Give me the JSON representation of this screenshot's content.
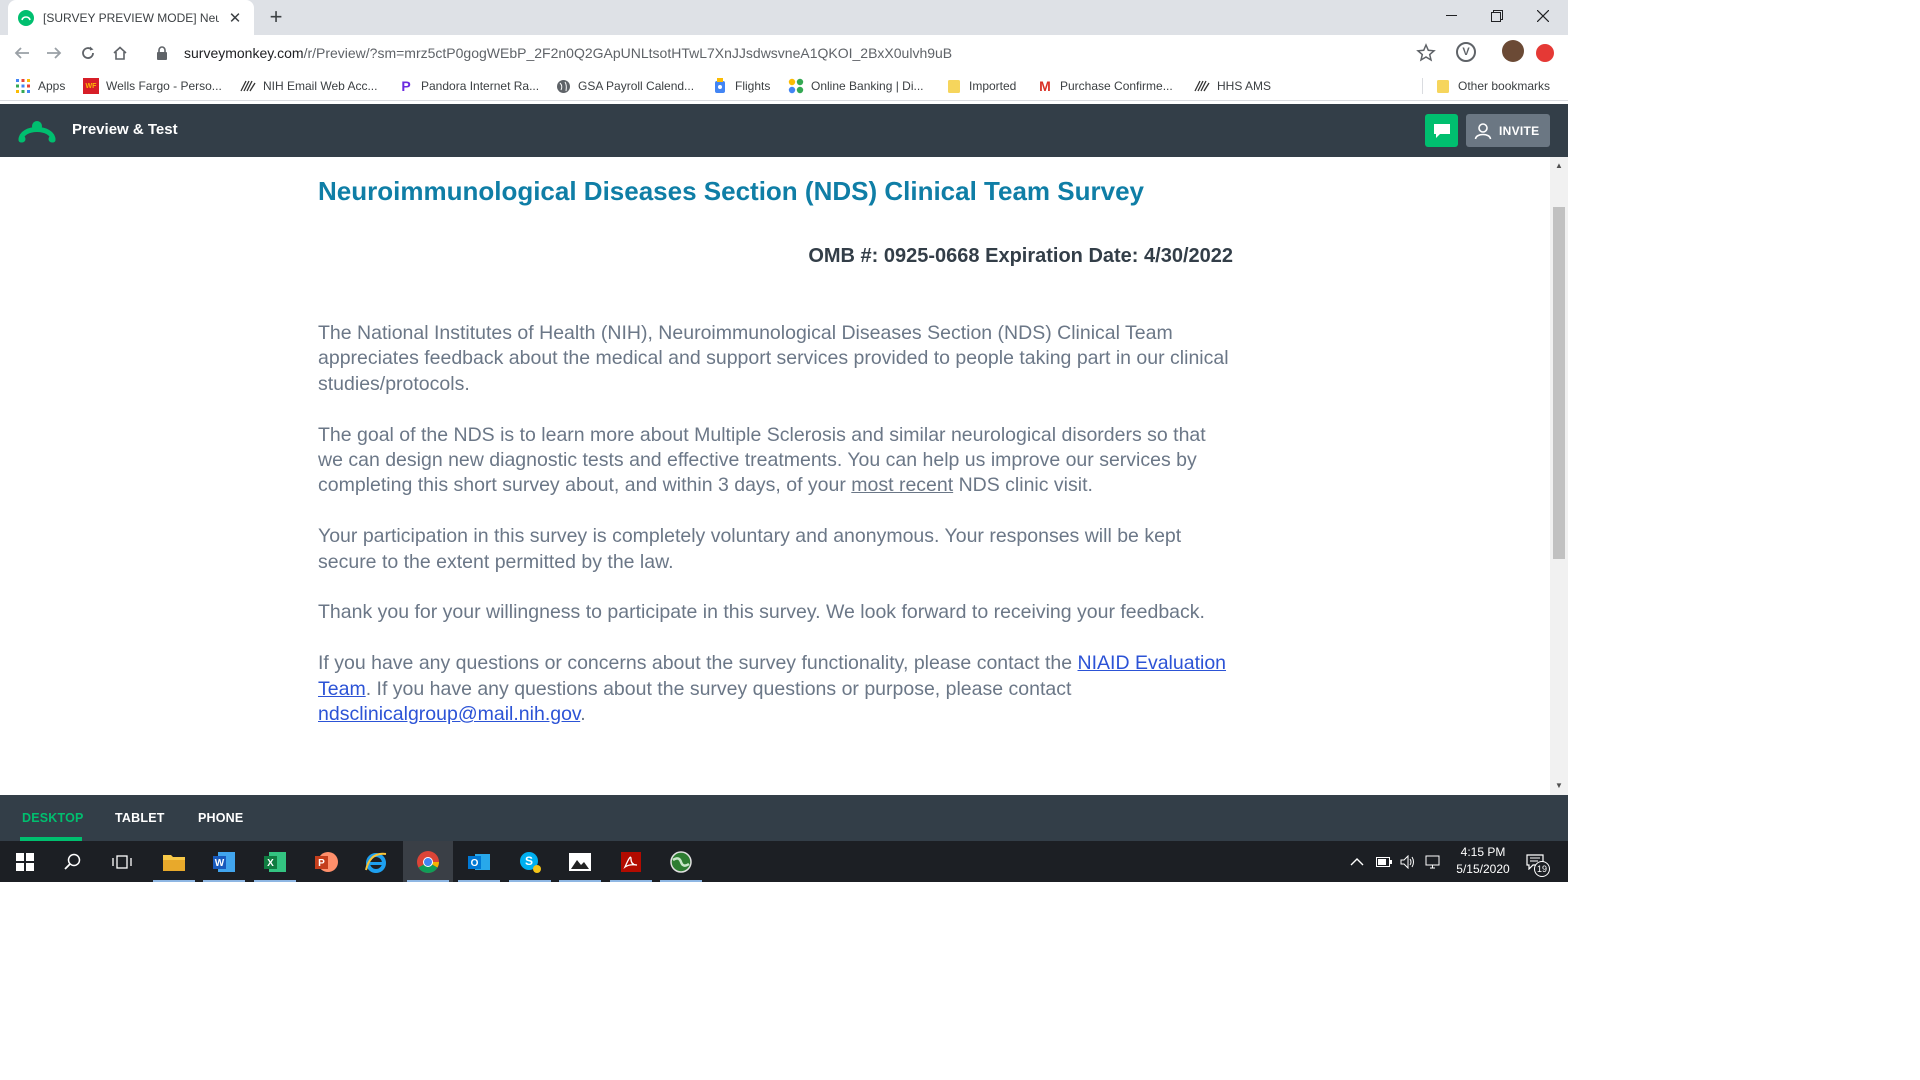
{
  "browser": {
    "tab_title": "[SURVEY PREVIEW MODE] Neuro",
    "url_host": "surveymonkey.com",
    "url_path": "/r/Preview/?sm=mrz5ctP0gogWEbP_2F2n0Q2GApUNLtsotHTwL7XnJJsdwsvneA1QKOI_2BxX0ulvh9uB",
    "bookmarks": [
      {
        "label": "Apps",
        "icon": "apps-grid-icon"
      },
      {
        "label": "Wells Fargo - Perso...",
        "icon": "wells-fargo-icon"
      },
      {
        "label": "NIH Email Web Acc...",
        "icon": "hhs-eagle-icon"
      },
      {
        "label": "Pandora Internet Ra...",
        "icon": "pandora-icon"
      },
      {
        "label": "GSA Payroll Calend...",
        "icon": "globe-icon"
      },
      {
        "label": "Flights",
        "icon": "flights-icon"
      },
      {
        "label": "Online Banking | Di...",
        "icon": "banking-icon"
      },
      {
        "label": "Imported",
        "icon": "folder-icon"
      },
      {
        "label": "Purchase Confirme...",
        "icon": "gmail-icon"
      },
      {
        "label": "HHS AMS",
        "icon": "hhs-eagle-icon"
      }
    ],
    "other_bookmarks": "Other bookmarks"
  },
  "sm_header": {
    "title": "Preview & Test",
    "invite_label": "INVITE"
  },
  "survey": {
    "title": "Neuroimmunological Diseases Section (NDS) Clinical Team Survey",
    "omb": "OMB #: 0925-0668 Expiration Date: 4/30/2022",
    "p1": "The National Institutes of Health (NIH), Neuroimmunological Diseases Section (NDS) Clinical Team appreciates feedback about the medical and support services provided to people taking part in our clinical studies/protocols.",
    "p2_before": "The goal of the NDS is to learn more about Multiple Sclerosis and similar neurological disorders so that we can design new diagnostic tests and effective treatments. You can help us improve our services by completing this short survey about, and within 3 days, of your ",
    "p2_underlined": "most recent",
    "p2_after": " NDS clinic visit.",
    "p3": "Your participation in this survey is completely voluntary and anonymous. Your responses will be kept secure to the extent permitted by the law.",
    "p4": "Thank you for your willingness to participate in this survey. We look forward to receiving your feedback.",
    "p5_before": "If you have any questions or concerns about the survey functionality, please contact the ",
    "p5_link1": "NIAID Evaluation Team",
    "p5_middle": ". If you have any questions about the survey questions or purpose, please contact ",
    "p5_link2": "ndsclinicalgroup@mail.nih.gov",
    "p5_after": "."
  },
  "device_tabs": {
    "desktop": "DESKTOP",
    "tablet": "TABLET",
    "phone": "PHONE",
    "active": "desktop"
  },
  "taskbar": {
    "time": "4:15 PM",
    "date": "5/15/2020",
    "notification_count": "19"
  },
  "colors": {
    "sm_green": "#00bf6f",
    "sm_dark": "#333e48",
    "title_blue": "#0f7ea6",
    "link_blue": "#2c53d6"
  }
}
